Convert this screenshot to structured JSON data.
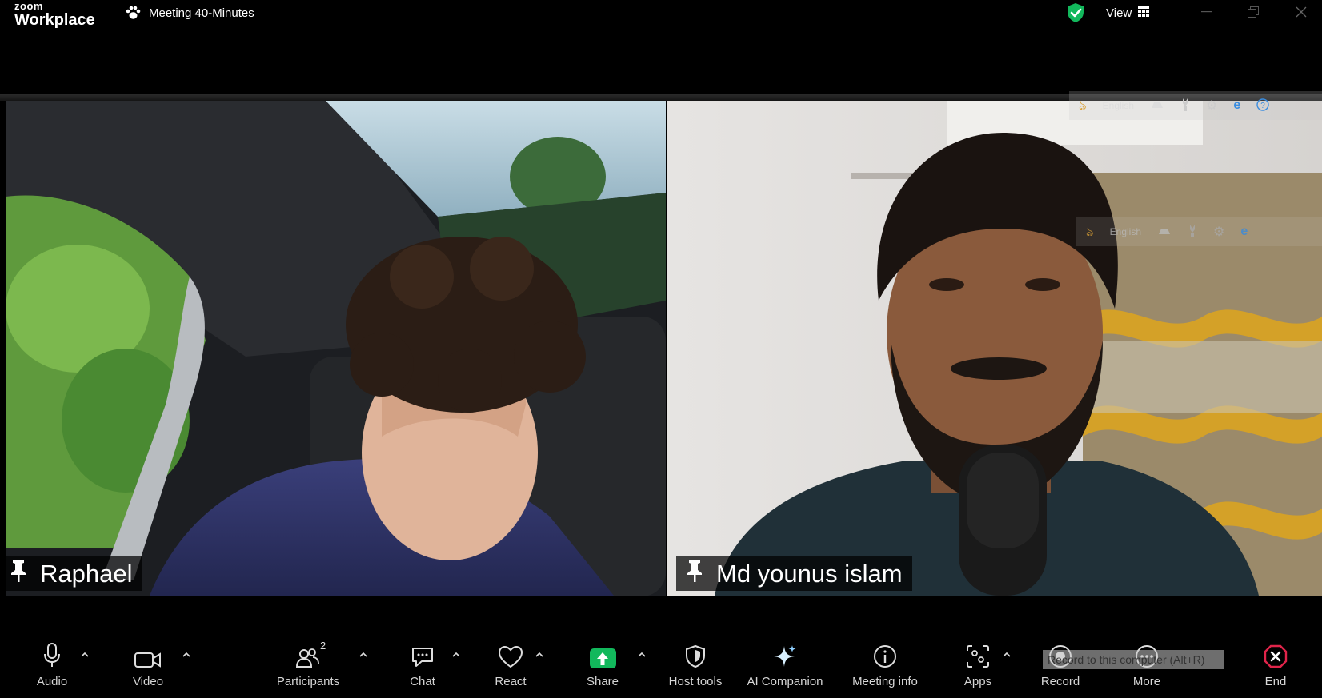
{
  "app": {
    "brand_top": "zoom",
    "brand_bottom": "Workplace"
  },
  "meeting": {
    "title": "Meeting 40-Minutes"
  },
  "header": {
    "view_label": "View"
  },
  "participants": [
    {
      "name": "Raphael"
    },
    {
      "name": "Md younus islam"
    }
  ],
  "overlay": {
    "language": "English"
  },
  "toolbar": {
    "audio": "Audio",
    "video": "Video",
    "participants": "Participants",
    "participants_count": "2",
    "chat": "Chat",
    "react": "React",
    "share": "Share",
    "host_tools": "Host tools",
    "ai_companion": "AI Companion",
    "meeting_info": "Meeting info",
    "apps": "Apps",
    "record": "Record",
    "more": "More",
    "end": "End"
  },
  "tooltip": {
    "text": "Record to this computer (Alt+R)"
  },
  "colors": {
    "share_green": "#12b85c",
    "end_red": "#e0244a",
    "shield_green": "#12b85c"
  }
}
